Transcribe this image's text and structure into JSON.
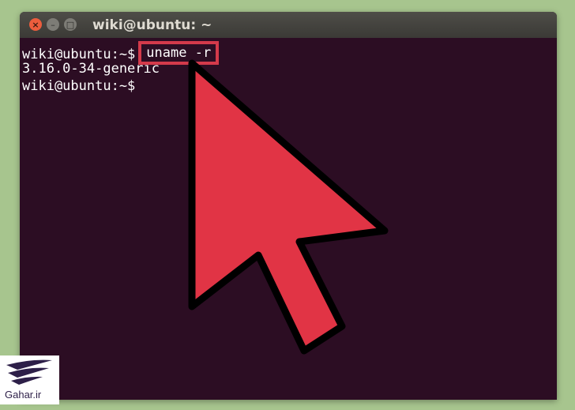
{
  "window": {
    "title": "wiki@ubuntu: ~"
  },
  "terminal": {
    "prompt": "wiki@ubuntu:~$",
    "command": "uname -r",
    "output": "3.16.0-34-generic",
    "prompt2": "wiki@ubuntu:~$"
  },
  "watermark": {
    "text": "Gahar.ir"
  },
  "colors": {
    "terminal_bg": "#2c0d23",
    "highlight": "#d43a4b",
    "cursor_fill": "#e13445"
  },
  "icons": {
    "close": "close-icon",
    "minimize": "minimize-icon",
    "maximize": "maximize-icon",
    "pointer": "mouse-pointer-icon"
  }
}
